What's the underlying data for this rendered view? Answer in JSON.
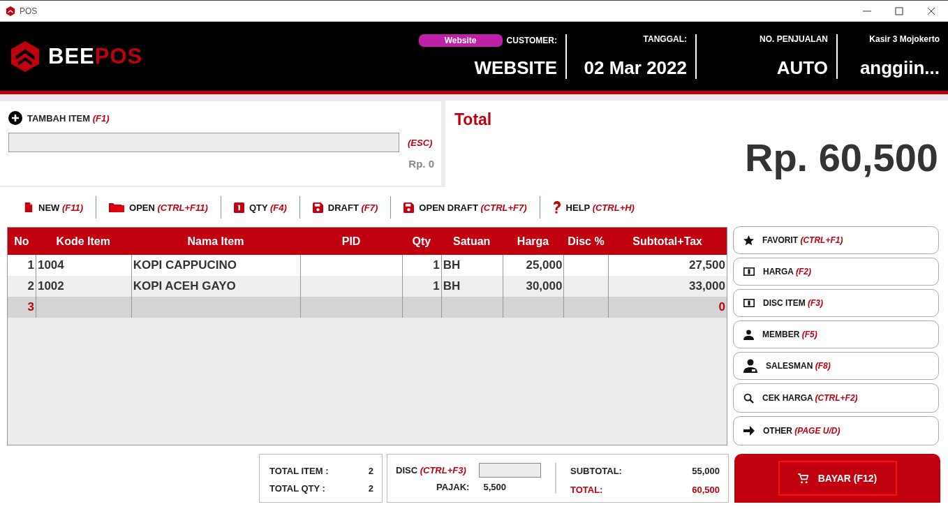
{
  "window": {
    "title": "POS"
  },
  "header": {
    "logo": {
      "first": "BEE",
      "second": "POS"
    },
    "channel_badge": "Website",
    "fields": [
      {
        "label": "CUSTOMER:",
        "value": "WEBSITE"
      },
      {
        "label": "TANGGAL:",
        "value": "02 Mar 2022"
      },
      {
        "label": "NO. PENJUALAN",
        "value": "AUTO"
      },
      {
        "label": "Kasir 3 Mojokerto",
        "value": "anggiin..."
      }
    ]
  },
  "add_item": {
    "label": "TAMBAH ITEM",
    "shortcut": "(F1)",
    "clear_shortcut": "(ESC)",
    "price": "Rp. 0"
  },
  "total": {
    "label": "Total",
    "amount": "Rp. 60,500"
  },
  "toolbar": [
    {
      "label": "NEW",
      "shortcut": "(F11)"
    },
    {
      "label": "OPEN",
      "shortcut": "(CTRL+F11)"
    },
    {
      "label": "QTY",
      "shortcut": "(F4)"
    },
    {
      "label": "DRAFT",
      "shortcut": "(F7)"
    },
    {
      "label": "OPEN DRAFT",
      "shortcut": "(CTRL+F7)"
    },
    {
      "label": "HELP",
      "shortcut": "(CTRL+H)"
    }
  ],
  "table": {
    "columns": [
      "No",
      "Kode Item",
      "Nama Item",
      "PID",
      "Qty",
      "Satuan",
      "Harga",
      "Disc %",
      "Subtotal+Tax"
    ],
    "rows": [
      {
        "selected": false,
        "cells": [
          "1",
          "1004",
          "KOPI CAPPUCINO",
          "",
          "1",
          "BH",
          "25,000",
          "",
          "27,500"
        ]
      },
      {
        "selected": false,
        "cells": [
          "2",
          "1002",
          "KOPI ACEH GAYO",
          "",
          "1",
          "BH",
          "30,000",
          "",
          "33,000"
        ]
      },
      {
        "selected": true,
        "cells": [
          "3",
          "",
          "",
          "",
          "",
          "",
          "",
          "",
          "0"
        ]
      }
    ]
  },
  "side_buttons": [
    {
      "label": "FAVORIT",
      "shortcut": "(CTRL+F1)"
    },
    {
      "label": "HARGA",
      "shortcut": "(F2)"
    },
    {
      "label": "DISC ITEM",
      "shortcut": "(F3)"
    },
    {
      "label": "MEMBER",
      "shortcut": "(F5)"
    },
    {
      "label": "SALESMAN",
      "shortcut": "(F8)"
    },
    {
      "label": "CEK HARGA",
      "shortcut": "(CTRL+F2)"
    },
    {
      "label": "OTHER",
      "shortcut": "(PAGE U/D)"
    }
  ],
  "summary": {
    "total_item": {
      "label": "TOTAL ITEM :",
      "value": "2"
    },
    "total_qty": {
      "label": "TOTAL QTY :",
      "value": "2"
    },
    "disc": {
      "label": "DISC",
      "shortcut": "(CTRL+F3)"
    },
    "pajak": {
      "label": "PAJAK:",
      "value": "5,500"
    },
    "subtotal": {
      "label": "SUBTOTAL:",
      "value": "55,000"
    },
    "grand_total": {
      "label": "TOTAL:",
      "value": "60,500"
    }
  },
  "pay_button": {
    "label": "BAYAR (F12)"
  }
}
